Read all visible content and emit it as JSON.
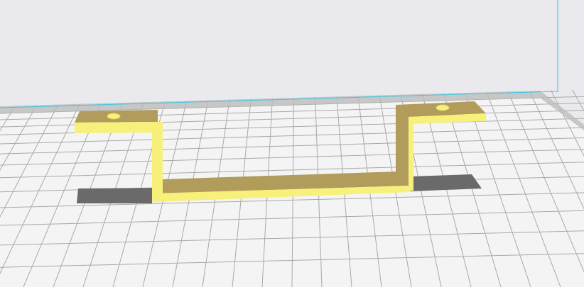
{
  "viewport": {
    "background_color": "#e9e9ee",
    "plate_color": "#f4f4f4",
    "grid_color": "#a9a9a9",
    "plate_edge_color": "#bcbcbc",
    "volume_edge_color": "#3fc8e0",
    "model_top_color": "#b29c5c",
    "model_side_color": "#f7f17c",
    "shadow_color": "#6a6a6a"
  }
}
